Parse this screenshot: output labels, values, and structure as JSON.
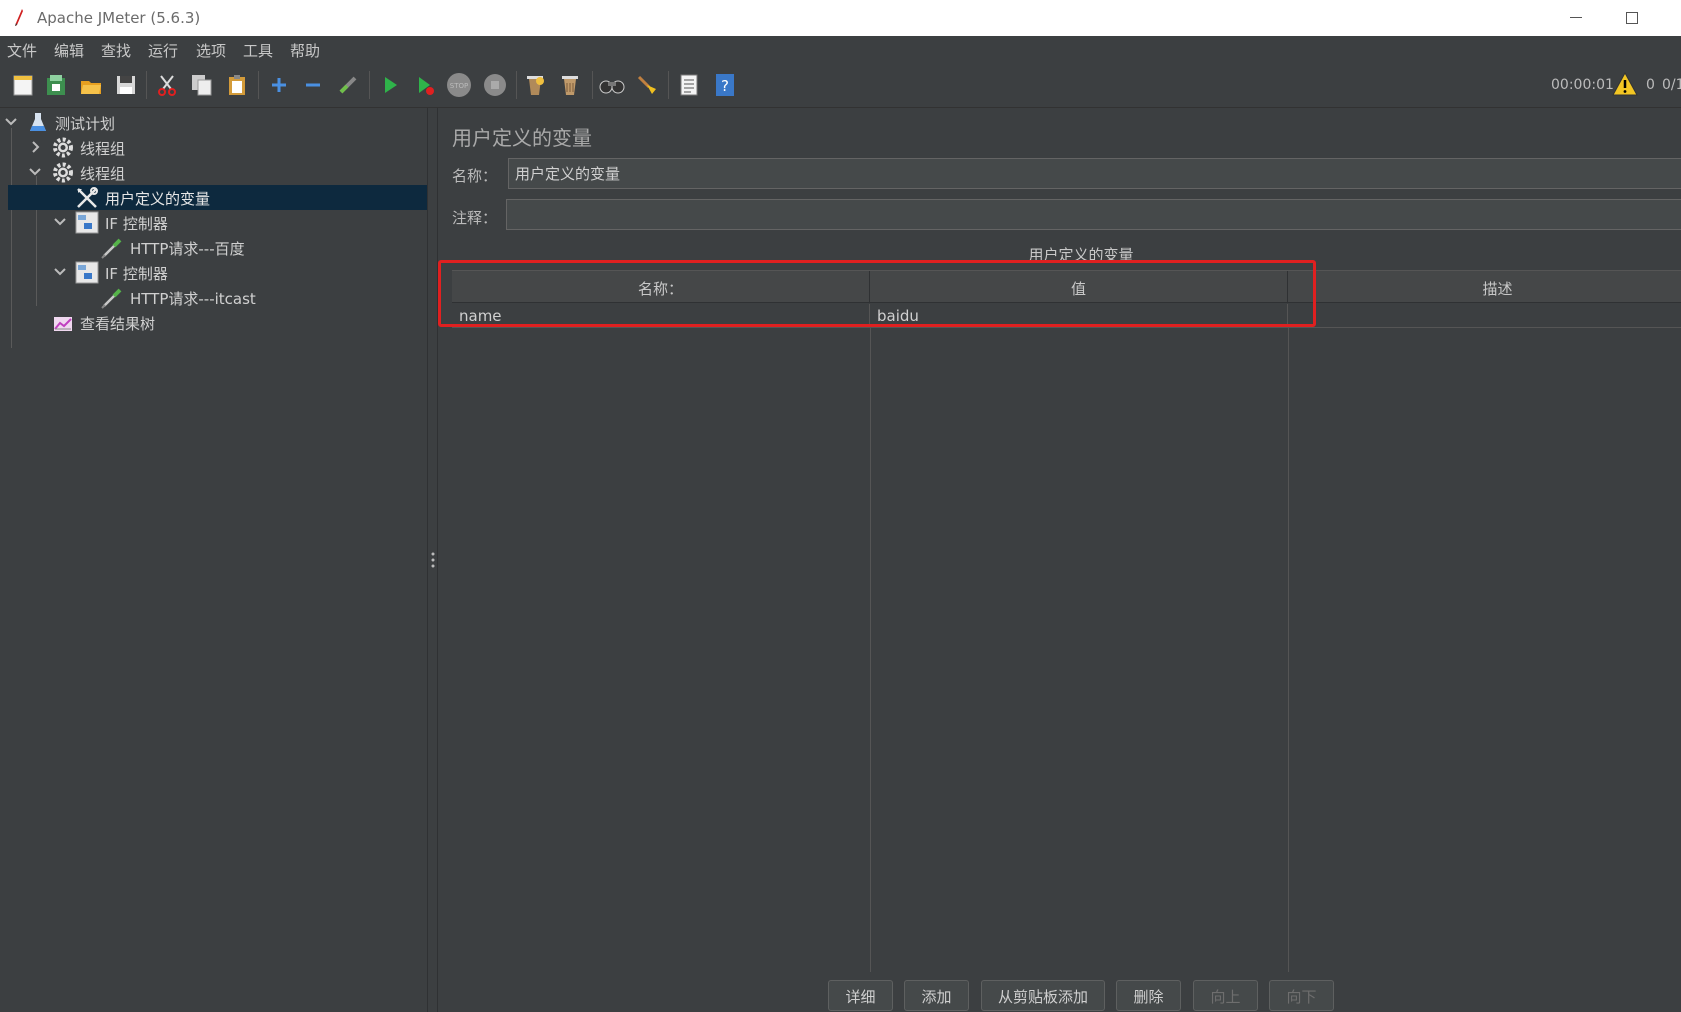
{
  "window": {
    "title": "Apache JMeter (5.6.3)"
  },
  "menu": [
    "文件",
    "编辑",
    "查找",
    "运行",
    "选项",
    "工具",
    "帮助"
  ],
  "toolbar": {
    "icons": [
      "new-icon",
      "templates-icon",
      "open-icon",
      "save-icon",
      "cut-icon",
      "copy-icon",
      "paste-icon",
      "expand-icon",
      "collapse-icon",
      "toggle-icon",
      "start-icon",
      "start-no-pause-icon",
      "stop-icon",
      "shutdown-icon",
      "clear-icon",
      "clear-all-icon",
      "search-icon",
      "reset-search-icon",
      "function-helper-icon",
      "help-icon"
    ],
    "timer": "00:00:01",
    "error_count": "0",
    "threads": "0/1"
  },
  "tree": [
    {
      "label": "测试计划",
      "icon": "test-plan-icon",
      "level": 0,
      "expanded": true
    },
    {
      "label": "线程组",
      "icon": "thread-group-icon",
      "level": 1,
      "expanded": false
    },
    {
      "label": "线程组",
      "icon": "thread-group-icon",
      "level": 1,
      "expanded": true
    },
    {
      "label": "用户定义的变量",
      "icon": "config-element-icon",
      "level": 2,
      "selected": true
    },
    {
      "label": "IF 控制器",
      "icon": "if-controller-icon",
      "level": 2,
      "expanded": true
    },
    {
      "label": "HTTP请求---百度",
      "icon": "sampler-icon",
      "level": 3
    },
    {
      "label": "IF 控制器",
      "icon": "if-controller-icon",
      "level": 2,
      "expanded": true
    },
    {
      "label": "HTTP请求---itcast",
      "icon": "sampler-icon",
      "level": 3
    },
    {
      "label": "查看结果树",
      "icon": "listener-icon",
      "level": 1
    }
  ],
  "panel": {
    "title": "用户定义的变量",
    "name_label": "名称：",
    "name_value": "用户定义的变量",
    "comment_label": "注释：",
    "comment_value": "",
    "table_caption": "用户定义的变量",
    "columns": [
      "名称：",
      "值",
      "描述"
    ],
    "rows": [
      [
        "name",
        "baidu",
        ""
      ]
    ]
  },
  "buttons": {
    "detail": "详细",
    "add": "添加",
    "add_clipboard": "从剪贴板添加",
    "delete": "删除",
    "up": "向上",
    "down": "向下"
  },
  "colors": {
    "background": "#3c3f41",
    "selection": "#0d293e",
    "highlight": "#e02020"
  }
}
